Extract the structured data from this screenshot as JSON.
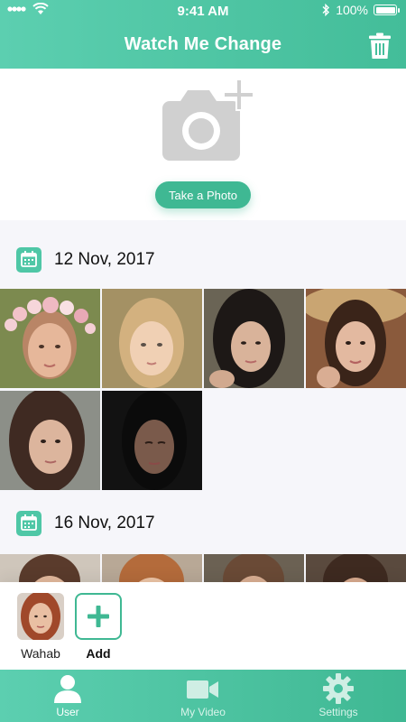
{
  "status_bar": {
    "time": "9:41 AM",
    "battery": "100%"
  },
  "header": {
    "title": "Watch Me Change"
  },
  "camera": {
    "button_label": "Take a Photo"
  },
  "sections": [
    {
      "date": "12 Nov, 2017",
      "photo_count": 6
    },
    {
      "date": "16 Nov, 2017",
      "photo_count": 4
    }
  ],
  "users": [
    {
      "name": "Wahab"
    }
  ],
  "add_user": {
    "label": "Add"
  },
  "tabs": [
    {
      "label": "User",
      "icon": "user-icon",
      "active": true
    },
    {
      "label": "My Video",
      "icon": "video-camera-icon",
      "active": false
    },
    {
      "label": "Settings",
      "icon": "gear-icon",
      "active": false
    }
  ],
  "colors": {
    "accent": "#3fb893",
    "header": "#4fc7a6",
    "icon_gray": "#d0d0d0"
  }
}
